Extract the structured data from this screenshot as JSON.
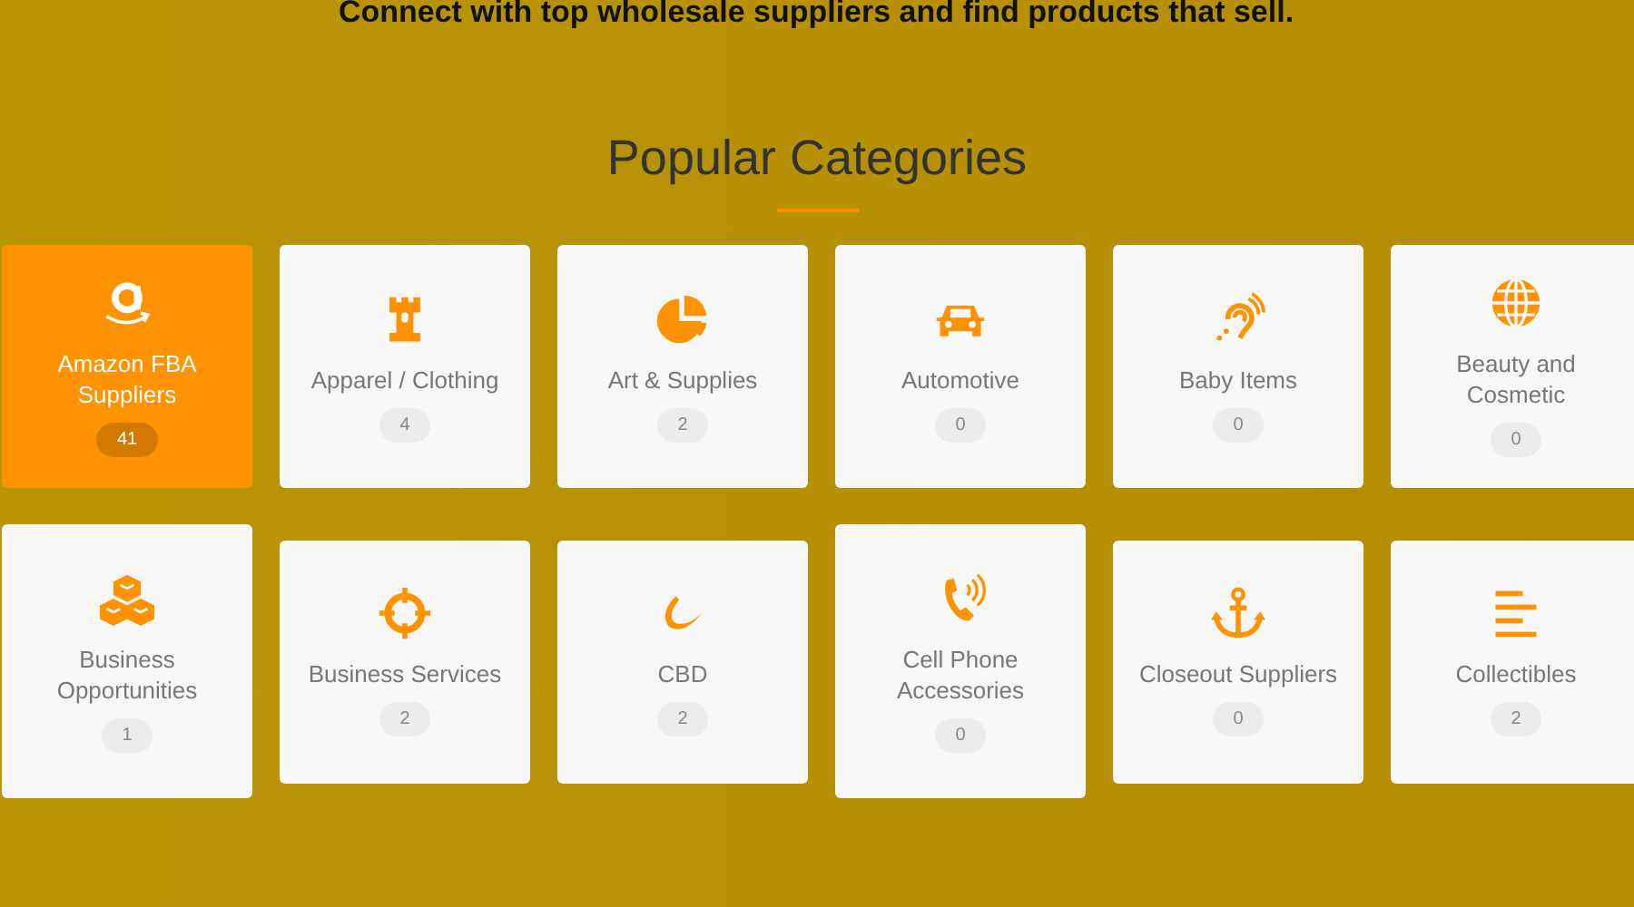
{
  "tagline": "Connect with top wholesale suppliers and find products that sell.",
  "section_title": "Popular Categories",
  "rows": [
    [
      {
        "label": "Amazon FBA Suppliers",
        "count": "41",
        "selected": true
      },
      {
        "label": "Apparel / Clothing",
        "count": "4",
        "selected": false
      },
      {
        "label": "Art & Supplies",
        "count": "2",
        "selected": false
      },
      {
        "label": "Automotive",
        "count": "0",
        "selected": false
      },
      {
        "label": "Baby Items",
        "count": "0",
        "selected": false
      },
      {
        "label": "Beauty and Cosmetic",
        "count": "0",
        "selected": false
      }
    ],
    [
      {
        "label": "Business Opportunities",
        "count": "1",
        "selected": false
      },
      {
        "label": "Business Services",
        "count": "2",
        "selected": false
      },
      {
        "label": "CBD",
        "count": "2",
        "selected": false
      },
      {
        "label": "Cell Phone Accessories",
        "count": "0",
        "selected": false
      },
      {
        "label": "Closeout Suppliers",
        "count": "0",
        "selected": false
      },
      {
        "label": "Collectibles",
        "count": "2",
        "selected": false
      }
    ]
  ]
}
